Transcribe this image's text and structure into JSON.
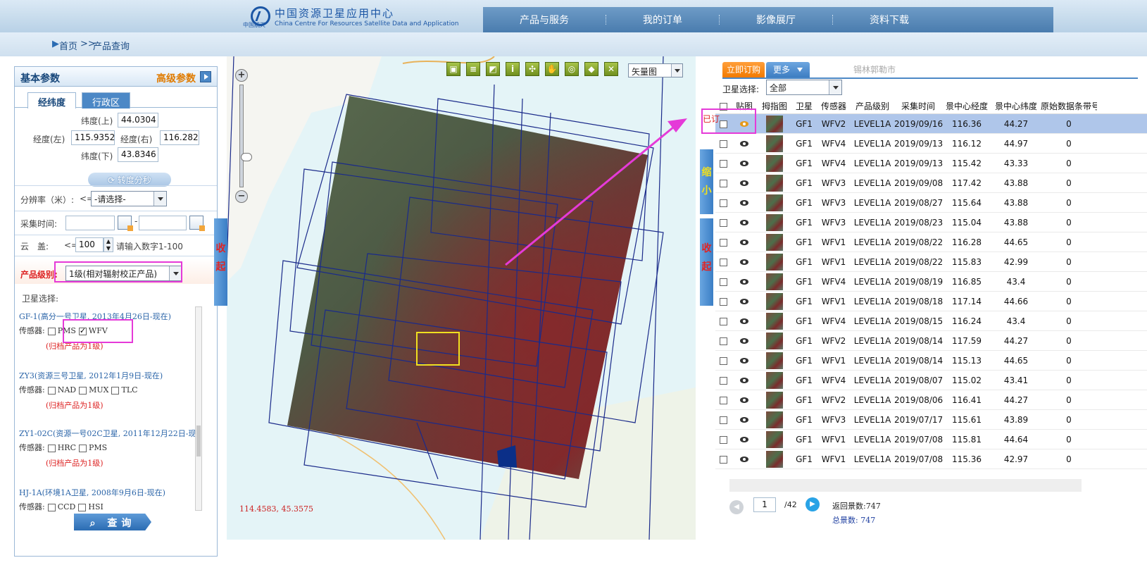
{
  "header": {
    "org_cn": "中国资源卫星应用中心",
    "org_en": "China Centre For Resources Satellite Data and Application",
    "logo_text": "中国航天",
    "nav": [
      "产品与服务",
      "我的订单",
      "影像展厅",
      "资料下载"
    ]
  },
  "breadcrumb": {
    "home": "首页",
    "sep": ">>",
    "current": "产品查询"
  },
  "left": {
    "panel_title": "基本参数",
    "advanced": "高级参数",
    "tab_latlon": "经纬度",
    "tab_admin": "行政区",
    "lat_top_label": "纬度(上)",
    "lat_top": "44.0304",
    "lon_left_label": "经度(左)",
    "lon_left": "115.9352",
    "lon_right_label": "经度(右)",
    "lon_right": "116.282",
    "lat_bottom_label": "纬度(下)",
    "lat_bottom": "43.8346",
    "convert_btn": "转度分秒",
    "resolution_label": "分辨率（米）:",
    "resolution_le": "<=",
    "resolution_value": "-请选择-",
    "time_label": "采集时间:",
    "cloud_label": "云　盖:",
    "cloud_le": "<=",
    "cloud_value": "100",
    "cloud_hint": "请输入数字1-100",
    "product_level_label": "产品级别:",
    "product_level_value": "1级(相对辐射校正产品)",
    "sat_select_label": "卫星选择:",
    "satellites": [
      {
        "title": "GF-1(高分一号卫星, 2013年4月26日-现在)",
        "sensors": [
          {
            "name": "PMS",
            "checked": false
          },
          {
            "name": "WFV",
            "checked": true
          }
        ],
        "note": "(归档产品为1级)"
      },
      {
        "title": "ZY3(资源三号卫星, 2012年1月9日-现在)",
        "sensors": [
          {
            "name": "NAD",
            "checked": false
          },
          {
            "name": "MUX",
            "checked": false
          },
          {
            "name": "TLC",
            "checked": false
          }
        ],
        "note": "(归档产品为1级)"
      },
      {
        "title": "ZY1-02C(资源一号02C卫星, 2011年12月22日-现在)",
        "sensors": [
          {
            "name": "HRC",
            "checked": false
          },
          {
            "name": "PMS",
            "checked": false
          }
        ],
        "note": "(归档产品为1级)"
      },
      {
        "title": "HJ-1A(环境1A卫星, 2008年9月6日-现在)",
        "sensors": [
          {
            "name": "CCD",
            "checked": false
          },
          {
            "name": "HSI",
            "checked": false
          }
        ],
        "note": ""
      }
    ],
    "sensor_label": "传感器:",
    "search_btn": "查询"
  },
  "map": {
    "maptype": "矢量图",
    "coord": "114.4583, 45.3575",
    "collapse_left": "收起",
    "shrink": "缩小",
    "collapse_right": "收起",
    "place_label": "锡林郭勒市"
  },
  "right": {
    "order_btn": "立即订购",
    "more_btn": "更多",
    "sat_select_label": "卫星选择:",
    "sat_select_value": "全部",
    "ordered_label": "已订",
    "columns": [
      "贴图",
      "拇指图",
      "卫星",
      "传感器",
      "产品级别",
      "采集时间",
      "景中心经度",
      "景中心纬度",
      "原始数据条带号"
    ],
    "rows": [
      {
        "sat": "GF1",
        "sensor": "WFV2",
        "level": "LEVEL1A",
        "date": "2019/09/16",
        "lon": "116.36",
        "lat": "44.27",
        "strip": "0"
      },
      {
        "sat": "GF1",
        "sensor": "WFV4",
        "level": "LEVEL1A",
        "date": "2019/09/13",
        "lon": "116.12",
        "lat": "44.97",
        "strip": "0"
      },
      {
        "sat": "GF1",
        "sensor": "WFV4",
        "level": "LEVEL1A",
        "date": "2019/09/13",
        "lon": "115.42",
        "lat": "43.33",
        "strip": "0"
      },
      {
        "sat": "GF1",
        "sensor": "WFV3",
        "level": "LEVEL1A",
        "date": "2019/09/08",
        "lon": "117.42",
        "lat": "43.88",
        "strip": "0"
      },
      {
        "sat": "GF1",
        "sensor": "WFV3",
        "level": "LEVEL1A",
        "date": "2019/08/27",
        "lon": "115.64",
        "lat": "43.88",
        "strip": "0"
      },
      {
        "sat": "GF1",
        "sensor": "WFV3",
        "level": "LEVEL1A",
        "date": "2019/08/23",
        "lon": "115.04",
        "lat": "43.88",
        "strip": "0"
      },
      {
        "sat": "GF1",
        "sensor": "WFV1",
        "level": "LEVEL1A",
        "date": "2019/08/22",
        "lon": "116.28",
        "lat": "44.65",
        "strip": "0"
      },
      {
        "sat": "GF1",
        "sensor": "WFV1",
        "level": "LEVEL1A",
        "date": "2019/08/22",
        "lon": "115.83",
        "lat": "42.99",
        "strip": "0"
      },
      {
        "sat": "GF1",
        "sensor": "WFV4",
        "level": "LEVEL1A",
        "date": "2019/08/19",
        "lon": "116.85",
        "lat": "43.4",
        "strip": "0"
      },
      {
        "sat": "GF1",
        "sensor": "WFV1",
        "level": "LEVEL1A",
        "date": "2019/08/18",
        "lon": "117.14",
        "lat": "44.66",
        "strip": "0"
      },
      {
        "sat": "GF1",
        "sensor": "WFV4",
        "level": "LEVEL1A",
        "date": "2019/08/15",
        "lon": "116.24",
        "lat": "43.4",
        "strip": "0"
      },
      {
        "sat": "GF1",
        "sensor": "WFV2",
        "level": "LEVEL1A",
        "date": "2019/08/14",
        "lon": "117.59",
        "lat": "44.27",
        "strip": "0"
      },
      {
        "sat": "GF1",
        "sensor": "WFV1",
        "level": "LEVEL1A",
        "date": "2019/08/14",
        "lon": "115.13",
        "lat": "44.65",
        "strip": "0"
      },
      {
        "sat": "GF1",
        "sensor": "WFV4",
        "level": "LEVEL1A",
        "date": "2019/08/07",
        "lon": "115.02",
        "lat": "43.41",
        "strip": "0"
      },
      {
        "sat": "GF1",
        "sensor": "WFV2",
        "level": "LEVEL1A",
        "date": "2019/08/06",
        "lon": "116.41",
        "lat": "44.27",
        "strip": "0"
      },
      {
        "sat": "GF1",
        "sensor": "WFV3",
        "level": "LEVEL1A",
        "date": "2019/07/17",
        "lon": "115.61",
        "lat": "43.89",
        "strip": "0"
      },
      {
        "sat": "GF1",
        "sensor": "WFV1",
        "level": "LEVEL1A",
        "date": "2019/07/08",
        "lon": "115.81",
        "lat": "44.64",
        "strip": "0"
      },
      {
        "sat": "GF1",
        "sensor": "WFV1",
        "level": "LEVEL1A",
        "date": "2019/07/08",
        "lon": "115.36",
        "lat": "42.97",
        "strip": "0"
      }
    ],
    "page_value": "1",
    "page_total": "/42",
    "returned": "返回景数:747",
    "total": "总景数: 747"
  },
  "colors": {
    "accent": "#4c88c6",
    "highlight": "#e53ad8",
    "order": "#f27a00"
  }
}
